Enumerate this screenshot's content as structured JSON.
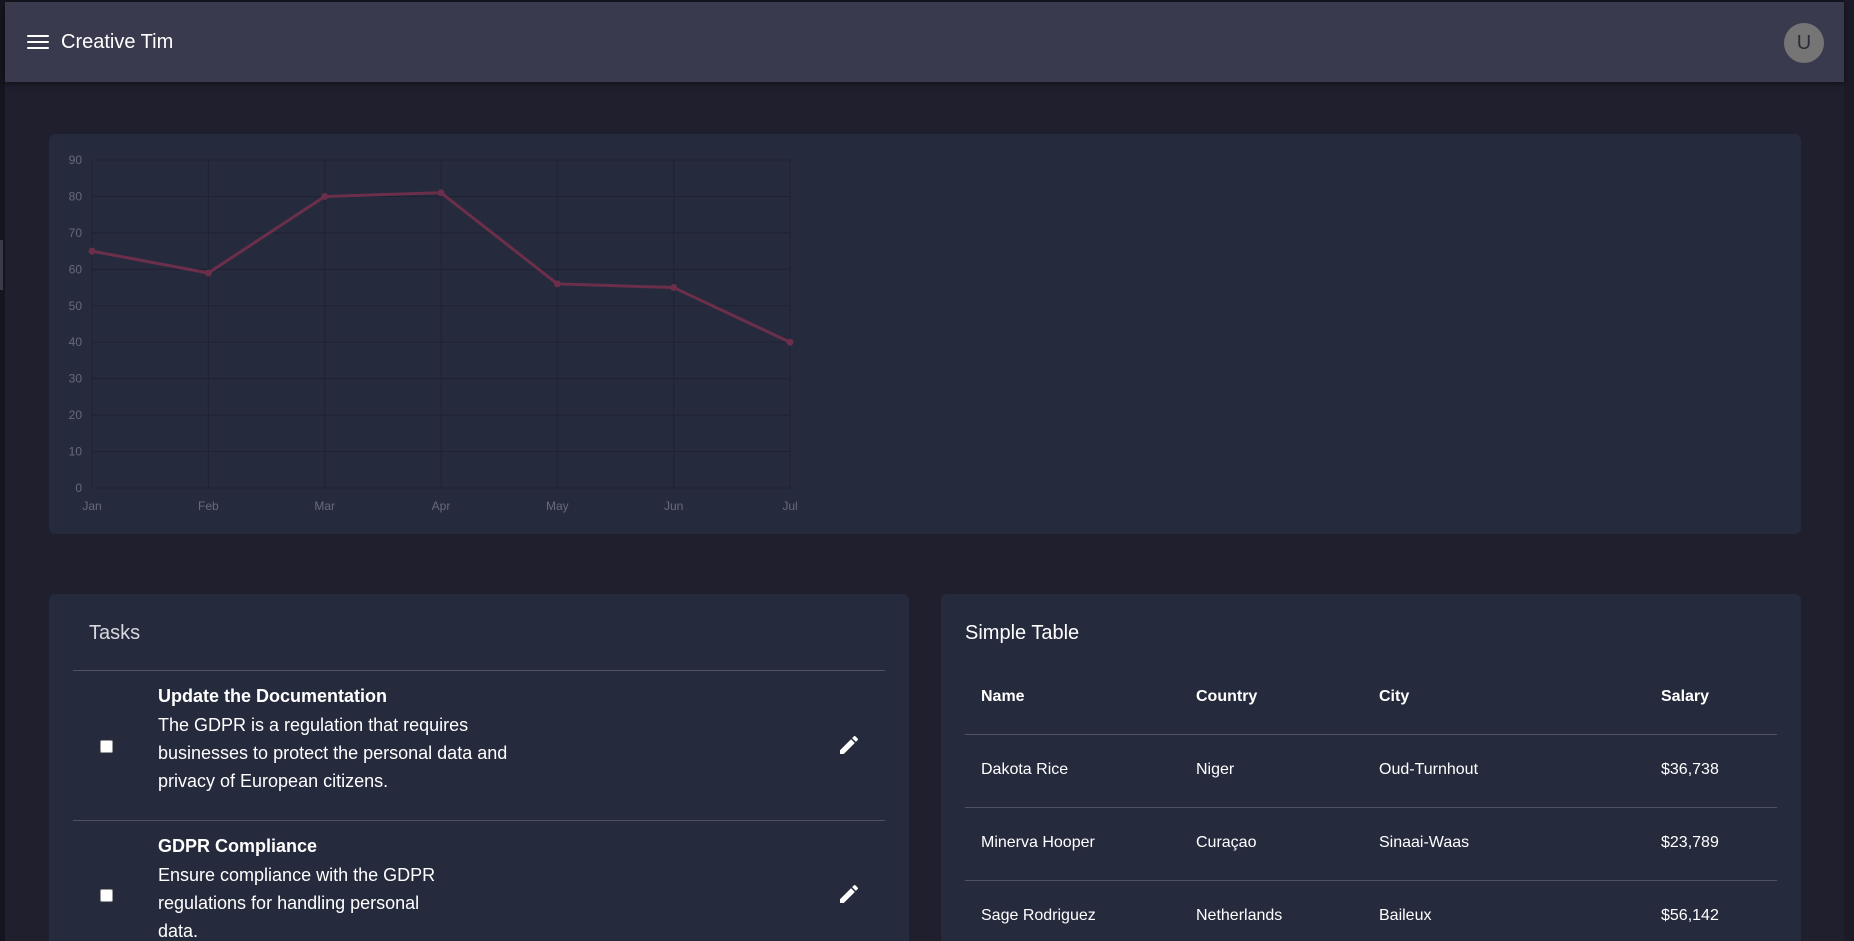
{
  "appbar": {
    "brand": "Creative Tim",
    "avatar_initial": "U"
  },
  "chart_data": {
    "type": "line",
    "categories": [
      "Jan",
      "Feb",
      "Mar",
      "Apr",
      "May",
      "Jun",
      "Jul"
    ],
    "series": [
      {
        "values": [
          65,
          59,
          80,
          81,
          56,
          55,
          40
        ],
        "color": "#6b2f4b"
      }
    ],
    "yticks": [
      0,
      10,
      20,
      30,
      40,
      50,
      60,
      70,
      80,
      90
    ],
    "ylim": [
      0,
      90
    ],
    "grid": true,
    "title": "",
    "xlabel": "",
    "ylabel": ""
  },
  "tasks": {
    "title": "Tasks",
    "items": [
      {
        "title": "Update the Documentation",
        "description_lines": [
          "The GDPR is a regulation that requires",
          "businesses to protect the personal data and",
          "privacy of European citizens."
        ]
      },
      {
        "title": "GDPR Compliance",
        "description_lines": [
          "Ensure compliance with the GDPR",
          "regulations for handling personal",
          "data."
        ]
      }
    ]
  },
  "table": {
    "title": "Simple Table",
    "headers": [
      "Name",
      "Country",
      "City",
      "Salary"
    ],
    "rows": [
      [
        "Dakota Rice",
        "Niger",
        "Oud-Turnhout",
        "$36,738"
      ],
      [
        "Minerva Hooper",
        "Curaçao",
        "Sinaai-Waas",
        "$23,789"
      ],
      [
        "Sage Rodriguez",
        "Netherlands",
        "Baileux",
        "$56,142"
      ]
    ]
  },
  "colors": {
    "background": "#1f1f2e",
    "card": "#262a3d",
    "appbar": "#3a3a4f",
    "line": "#6b2f4b"
  }
}
